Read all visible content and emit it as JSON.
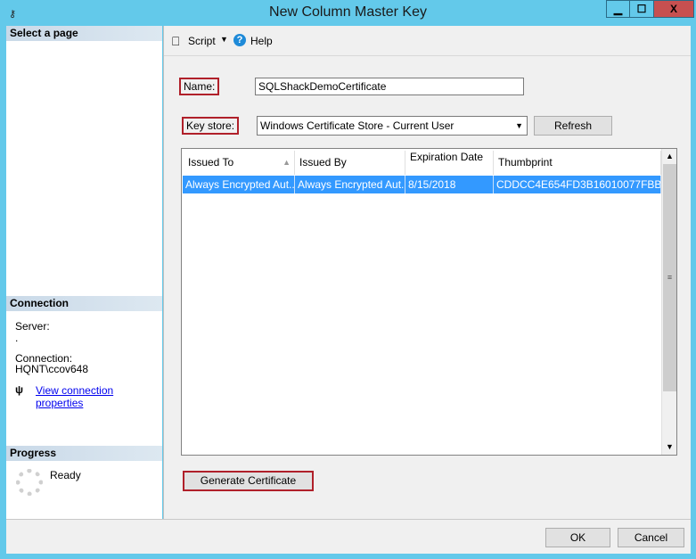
{
  "window": {
    "title": "New Column Master Key",
    "minimize": "▁",
    "maximize": "☐",
    "close": "X"
  },
  "sidebar": {
    "select_page": "Select a page",
    "connection_header": "Connection",
    "server_label": "Server:",
    "server_value": ".",
    "connection_label": "Connection:",
    "connection_value": "HQNT\\ccov648",
    "view_connection_link": "View connection properties",
    "progress_header": "Progress",
    "progress_status": "Ready"
  },
  "toolbar": {
    "script_label": "Script",
    "help_label": "Help"
  },
  "form": {
    "name_label": "Name:",
    "name_value": "SQLShackDemoCertificate",
    "keystore_label": "Key store:",
    "keystore_value": "Windows Certificate Store - Current User",
    "refresh_label": "Refresh",
    "generate_label": "Generate Certificate"
  },
  "grid": {
    "columns": [
      "Issued To",
      "Issued By",
      "Expiration Date",
      "Thumbprint"
    ],
    "rows": [
      {
        "issued_to": "Always Encrypted Aut...",
        "issued_by": "Always Encrypted Aut...",
        "expiration": "8/15/2018",
        "thumbprint": "CDDCC4E654FD3B16010077FBBD..."
      }
    ]
  },
  "footer": {
    "ok_label": "OK",
    "cancel_label": "Cancel"
  }
}
